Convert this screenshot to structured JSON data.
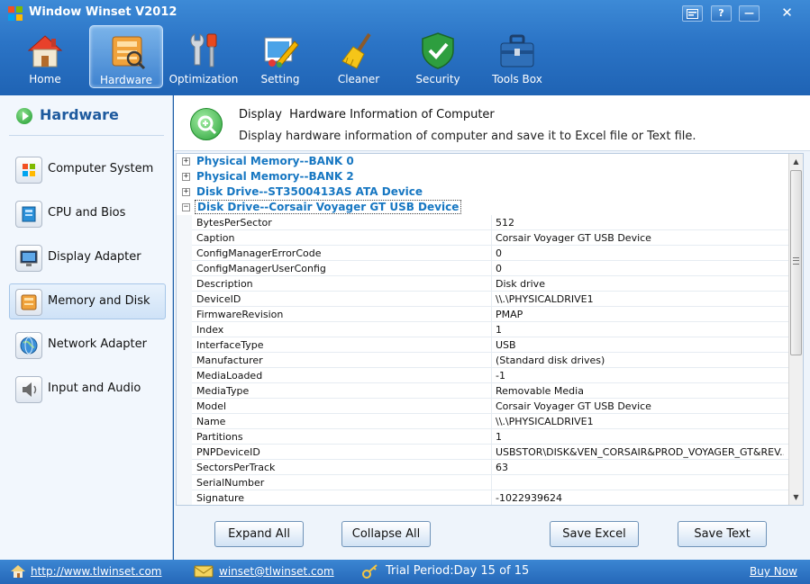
{
  "app": {
    "title": "Window Winset V2012"
  },
  "window_controls": {
    "help": "?",
    "minimize": "—",
    "close": "✕"
  },
  "toolbar": {
    "items": [
      {
        "label": "Home",
        "icon": "home-icon"
      },
      {
        "label": "Hardware",
        "icon": "hardware-icon",
        "active": true
      },
      {
        "label": "Optimization",
        "icon": "optimization-icon"
      },
      {
        "label": "Setting",
        "icon": "setting-icon"
      },
      {
        "label": "Cleaner",
        "icon": "broom-icon"
      },
      {
        "label": "Security",
        "icon": "shield-icon"
      },
      {
        "label": "Tools Box",
        "icon": "toolbox-icon"
      }
    ]
  },
  "sidebar": {
    "title": "Hardware",
    "items": [
      {
        "label": "Computer System",
        "icon": "windows-icon"
      },
      {
        "label": "CPU and Bios",
        "icon": "cpu-icon"
      },
      {
        "label": "Display Adapter",
        "icon": "monitor-icon"
      },
      {
        "label": "Memory and Disk",
        "icon": "disk-icon",
        "active": true
      },
      {
        "label": "Network Adapter",
        "icon": "globe-icon"
      },
      {
        "label": "Input and Audio",
        "icon": "speaker-icon"
      }
    ]
  },
  "main": {
    "title": "Display  Hardware Information of Computer",
    "description": "Display hardware information of computer and save it to Excel file or Text file.",
    "sections": [
      {
        "title": "Physical Memory--BANK 0",
        "expander": "+"
      },
      {
        "title": "Physical Memory--BANK 2",
        "expander": "+"
      },
      {
        "title": "Disk Drive--ST3500413AS ATA Device",
        "expander": "+"
      },
      {
        "title": "Disk Drive--Corsair Voyager GT USB Device",
        "expander": "−"
      }
    ],
    "properties": [
      {
        "name": "BytesPerSector",
        "value": "512"
      },
      {
        "name": "Caption",
        "value": "Corsair Voyager GT USB Device"
      },
      {
        "name": "ConfigManagerErrorCode",
        "value": "0"
      },
      {
        "name": "ConfigManagerUserConfig",
        "value": "0"
      },
      {
        "name": "Description",
        "value": "Disk drive"
      },
      {
        "name": "DeviceID",
        "value": "\\\\.\\PHYSICALDRIVE1"
      },
      {
        "name": "FirmwareRevision",
        "value": "PMAP"
      },
      {
        "name": "Index",
        "value": "1"
      },
      {
        "name": "InterfaceType",
        "value": "USB"
      },
      {
        "name": "Manufacturer",
        "value": "(Standard disk drives)"
      },
      {
        "name": "MediaLoaded",
        "value": "-1"
      },
      {
        "name": "MediaType",
        "value": "Removable Media"
      },
      {
        "name": "Model",
        "value": "Corsair Voyager GT USB Device"
      },
      {
        "name": "Name",
        "value": "\\\\.\\PHYSICALDRIVE1"
      },
      {
        "name": "Partitions",
        "value": "1"
      },
      {
        "name": "PNPDeviceID",
        "value": "USBSTOR\\DISK&VEN_CORSAIR&PROD_VOYAGER_GT&REV..."
      },
      {
        "name": "SectorsPerTrack",
        "value": "63"
      },
      {
        "name": "SerialNumber",
        "value": ""
      },
      {
        "name": "Signature",
        "value": "-1022939624"
      }
    ],
    "buttons": {
      "expand_all": "Expand All",
      "collapse_all": "Collapse All",
      "save_excel": "Save Excel",
      "save_text": "Save Text"
    }
  },
  "statusbar": {
    "website": "http://www.tlwinset.com",
    "email": "winset@tlwinset.com",
    "trial": "Trial Period:Day 15 of 15",
    "buy": "Buy Now"
  },
  "colors": {
    "accent": "#2b74c6",
    "section_title": "#1777c2",
    "panel_bg": "#f2f7fd"
  }
}
